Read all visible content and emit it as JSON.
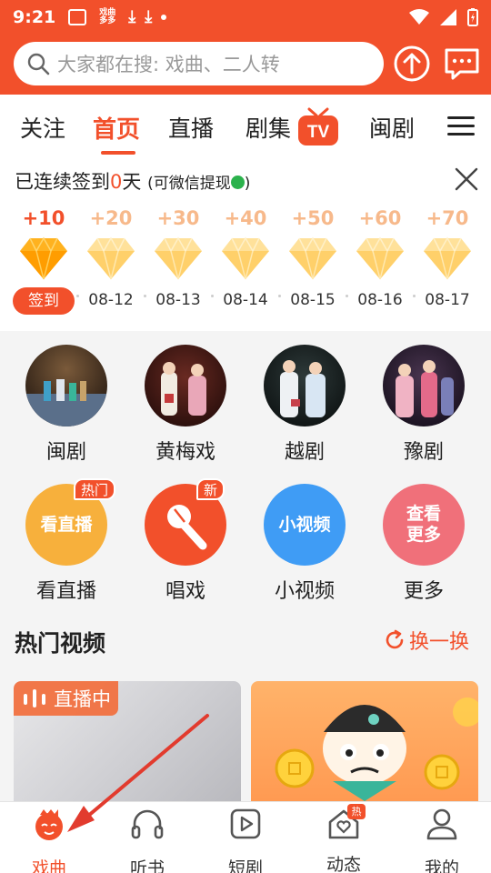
{
  "status_bar": {
    "time": "9:21",
    "app_badge": "戏曲\n多多"
  },
  "search": {
    "placeholder": "大家都在搜: 戏曲、二人转"
  },
  "tabs": [
    {
      "label": "关注"
    },
    {
      "label": "首页",
      "active": true
    },
    {
      "label": "直播"
    },
    {
      "label": "剧集"
    },
    {
      "label": "闽剧"
    }
  ],
  "tab_badge": "TV",
  "signin": {
    "prefix": "已连续签到",
    "days": "0",
    "suffix": "天",
    "note_open": "(可微信提现",
    "note_close": ")",
    "items": [
      {
        "points": "+10",
        "date": "签到"
      },
      {
        "points": "+20",
        "date": "08-12"
      },
      {
        "points": "+30",
        "date": "08-13"
      },
      {
        "points": "+40",
        "date": "08-14"
      },
      {
        "points": "+50",
        "date": "08-15"
      },
      {
        "points": "+60",
        "date": "08-16"
      },
      {
        "points": "+70",
        "date": "08-17"
      }
    ]
  },
  "categories": [
    {
      "label": "闽剧"
    },
    {
      "label": "黄梅戏"
    },
    {
      "label": "越剧"
    },
    {
      "label": "豫剧"
    }
  ],
  "features": [
    {
      "label": "看直播",
      "icon_text": "看直播",
      "badge": "热门",
      "color": "#f7b03c"
    },
    {
      "label": "唱戏",
      "badge": "新",
      "color": "#f2502b"
    },
    {
      "label": "小视频",
      "icon_text": "小视频",
      "color": "#3f9cf5"
    },
    {
      "label": "更多",
      "icon_text": "查看\n更多",
      "color": "#f0707a"
    }
  ],
  "hot_videos": {
    "title": "热门视频",
    "refresh_label": "换一换",
    "live_tag": "直播中"
  },
  "bottom_nav": [
    {
      "label": "戏曲",
      "active": true
    },
    {
      "label": "听书"
    },
    {
      "label": "短剧"
    },
    {
      "label": "动态",
      "badge": "热"
    },
    {
      "label": "我的"
    }
  ]
}
